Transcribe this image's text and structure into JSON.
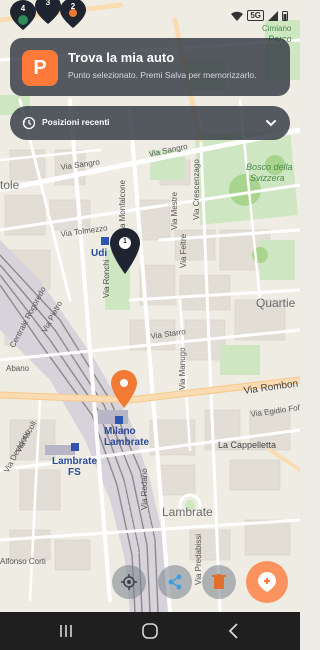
{
  "status_bar": {
    "network": "5G",
    "cluster_pins": [
      "4",
      "3",
      "2"
    ]
  },
  "location_card": {
    "icon_letter": "P",
    "title": "Trova la mia auto",
    "subtitle": "Punto selezionato. Premi Salva per memorizzarlo."
  },
  "recent_positions": {
    "label": "Posizioni recenti"
  },
  "map": {
    "pin_number": "1",
    "labels": {
      "cimiano": "Cimiano",
      "parco": "Parco",
      "via_sangro": "Via Sangro",
      "via_sangro2": "Via Sangro",
      "bosco": "Bosco della",
      "bosco2": "Svizzera",
      "tole": "tole",
      "via_tolmezzo": "Via Tolmezzo",
      "via_mestre": "Via Mestre",
      "via_feltre": "Via Feltre",
      "via_crescenzago": "Via Crescenzago",
      "via_monfalcone": "Via Monfalcone",
      "via_ronchi": "Via Ronchi",
      "udine": "Udi",
      "quartiere": "Quartie",
      "via_pietro": "Via Pietro",
      "via_starro": "Via Starro",
      "via_manugo": "Via Manugo",
      "centrale": "Centrale Rogoredo",
      "abano": "Abano",
      "via_rombon": "Via Rombon",
      "via_egidio": "Via Egidio Folli",
      "milano_lambrate": "Milano",
      "milano_lambrate2": "Lambrate",
      "lambrate_fs": "Lambrate",
      "lambrate_fs2": "FS",
      "via_ascoli": "Via Ascoli",
      "via_desiderio": "Via Desiderio",
      "la_cappelletta": "La Cappelletta",
      "lambrate": "Lambrate",
      "via_rodano": "Via Rodano",
      "alfonso": "Alfonso Corti",
      "via_predabissi": "Via Predabissi"
    }
  },
  "actions": {
    "locate_icon": "crosshair-icon",
    "share_icon": "share-icon",
    "delete_icon": "trash-icon",
    "save_icon": "save-pin-icon"
  },
  "navigation": {
    "recent_icon": "recent-apps-icon",
    "home_icon": "home-icon",
    "back_icon": "back-icon"
  }
}
